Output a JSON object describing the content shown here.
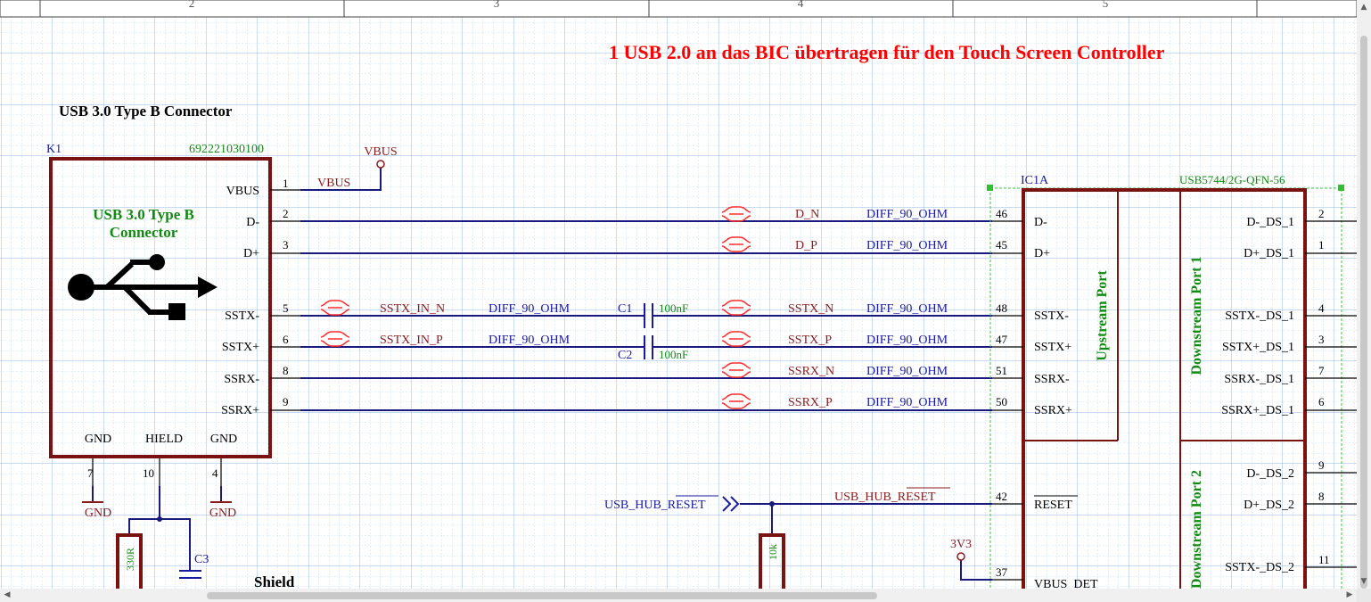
{
  "colors": {
    "grid": "#9ec3e8",
    "border": "#7a1212",
    "wire": "#1a1a7e",
    "net_label": "#8b1a1a",
    "designator": "#1a1a9e",
    "value_green": "#138a13",
    "title_red": "#ff0000",
    "text_black": "#000000"
  },
  "frame": {
    "zones": [
      "2",
      "3",
      "4",
      "5"
    ]
  },
  "title": "1 USB 2.0 an das BIC übertragen für den Touch Screen Controller",
  "connector": {
    "heading": "USB 3.0 Type B Connector",
    "designator": "K1",
    "part_number": "692221030100",
    "body_label_line1": "USB 3.0 Type B",
    "body_label_line2": "Connector",
    "logo_icon": "usb-icon",
    "pins": [
      {
        "name": "VBUS",
        "number": "1"
      },
      {
        "name": "D-",
        "number": "2"
      },
      {
        "name": "D+",
        "number": "3"
      },
      {
        "name": "SSTX-",
        "number": "5"
      },
      {
        "name": "SSTX+",
        "number": "6"
      },
      {
        "name": "SSRX-",
        "number": "8"
      },
      {
        "name": "SSRX+",
        "number": "9"
      }
    ],
    "bottom_pins": [
      {
        "name": "GND",
        "number": "7"
      },
      {
        "name": "HIELD",
        "number": "10"
      },
      {
        "name": "GND",
        "number": "4"
      }
    ]
  },
  "power": {
    "vbus_port": "VBUS",
    "vbus_net": "VBUS",
    "gnd_1": "GND",
    "gnd_2": "GND",
    "v3v3": "3V3"
  },
  "nets": {
    "d_n": "D_N",
    "d_p": "D_P",
    "sstx_in_n": "SSTX_IN_N",
    "sstx_in_p": "SSTX_IN_P",
    "sstx_n": "SSTX_N",
    "sstx_p": "SSTX_P",
    "ssrx_n": "SSRX_N",
    "ssrx_p": "SSRX_P",
    "diff_class": "DIFF_90_OHM",
    "reset_port": "USB_HUB_RESET",
    "reset_net": "USB_HUB_RESET"
  },
  "components": {
    "c1": {
      "designator": "C1",
      "value": "100nF"
    },
    "c2": {
      "designator": "C2",
      "value": "100nF"
    },
    "c3": {
      "designator": "C3"
    },
    "r_330": {
      "value": "330R"
    },
    "r_10k": {
      "value": "10k"
    },
    "shield_label": "Shield"
  },
  "ic": {
    "designator": "IC1A",
    "part_number": "USB5744/2G-QFN-56",
    "upstream_label": "Upstream Port",
    "downstream1_label": "Downstream Port 1",
    "downstream2_label": "Downstream Port 2",
    "left_pins": [
      {
        "number": "46",
        "name": "D-"
      },
      {
        "number": "45",
        "name": "D+"
      },
      {
        "number": "48",
        "name": "SSTX-"
      },
      {
        "number": "47",
        "name": "SSTX+"
      },
      {
        "number": "51",
        "name": "SSRX-"
      },
      {
        "number": "50",
        "name": "SSRX+"
      },
      {
        "number": "42",
        "name": "RESET"
      },
      {
        "number": "37",
        "name": "VBUS_DET"
      }
    ],
    "right_pins": [
      {
        "number": "2",
        "name": "D-_DS_1"
      },
      {
        "number": "1",
        "name": "D+_DS_1"
      },
      {
        "number": "4",
        "name": "SSTX-_DS_1"
      },
      {
        "number": "3",
        "name": "SSTX+_DS_1"
      },
      {
        "number": "7",
        "name": "SSRX-_DS_1"
      },
      {
        "number": "6",
        "name": "SSRX+_DS_1"
      },
      {
        "number": "9",
        "name": "D-_DS_2"
      },
      {
        "number": "8",
        "name": "D+_DS_2"
      },
      {
        "number": "11",
        "name": "SSTX-_DS_2"
      }
    ]
  }
}
